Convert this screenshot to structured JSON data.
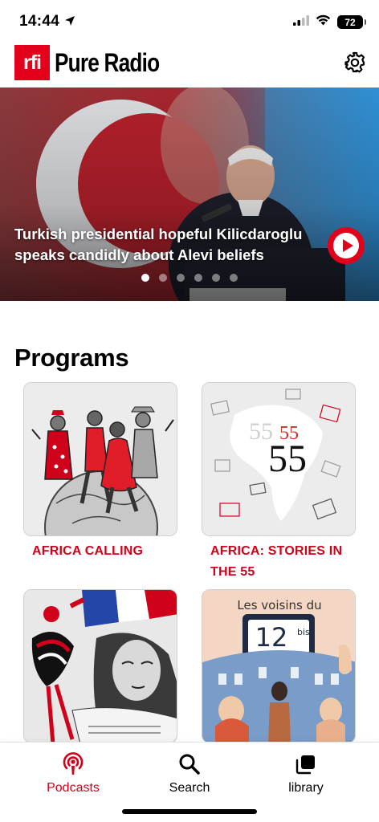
{
  "status": {
    "time": "14:44",
    "battery": "72"
  },
  "header": {
    "logo_mark": "rfi",
    "app_title": "Pure Radio",
    "settings_icon": "gear-icon"
  },
  "hero": {
    "title": "Turkish presidential hopeful Kilicdaroglu speaks candidly about Alevi beliefs",
    "play_icon": "play-icon",
    "slide_count": 6,
    "active_slide": 1
  },
  "programs": {
    "heading": "Programs",
    "items": [
      {
        "title": "AFRICA CALLING"
      },
      {
        "title": "AFRICA: STORIES IN THE 55",
        "art_text_a": "55",
        "art_text_b": "55",
        "art_text_c": "55"
      },
      {
        "title": ""
      },
      {
        "title": "",
        "art_text_a": "Les voisins du",
        "art_text_b": "12",
        "art_text_c": "bis"
      }
    ]
  },
  "tab_bar": {
    "tabs": [
      {
        "label": "Podcasts",
        "icon": "podcast-icon",
        "active": true
      },
      {
        "label": "Search",
        "icon": "search-icon",
        "active": false
      },
      {
        "label": "library",
        "icon": "library-icon",
        "active": false
      }
    ],
    "accent_color": "#d0021b"
  },
  "colors": {
    "brand_red": "#e2001a",
    "accent_red": "#d0021b"
  }
}
